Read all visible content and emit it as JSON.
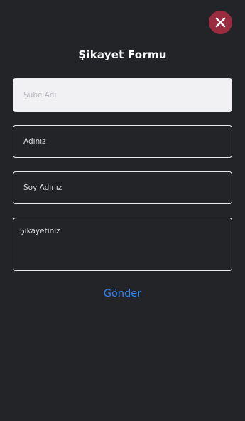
{
  "header": {
    "title": "Şikayet Formu",
    "close_icon": "close-icon",
    "close_color": "#9b2c40"
  },
  "form": {
    "branch_placeholder": "Şube Adı",
    "name_placeholder": "Adınız",
    "surname_placeholder": "Soy Adınız",
    "complaint_placeholder": "Şikayetiniz",
    "submit_label": "Gönder",
    "submit_color": "#2f86f3"
  }
}
